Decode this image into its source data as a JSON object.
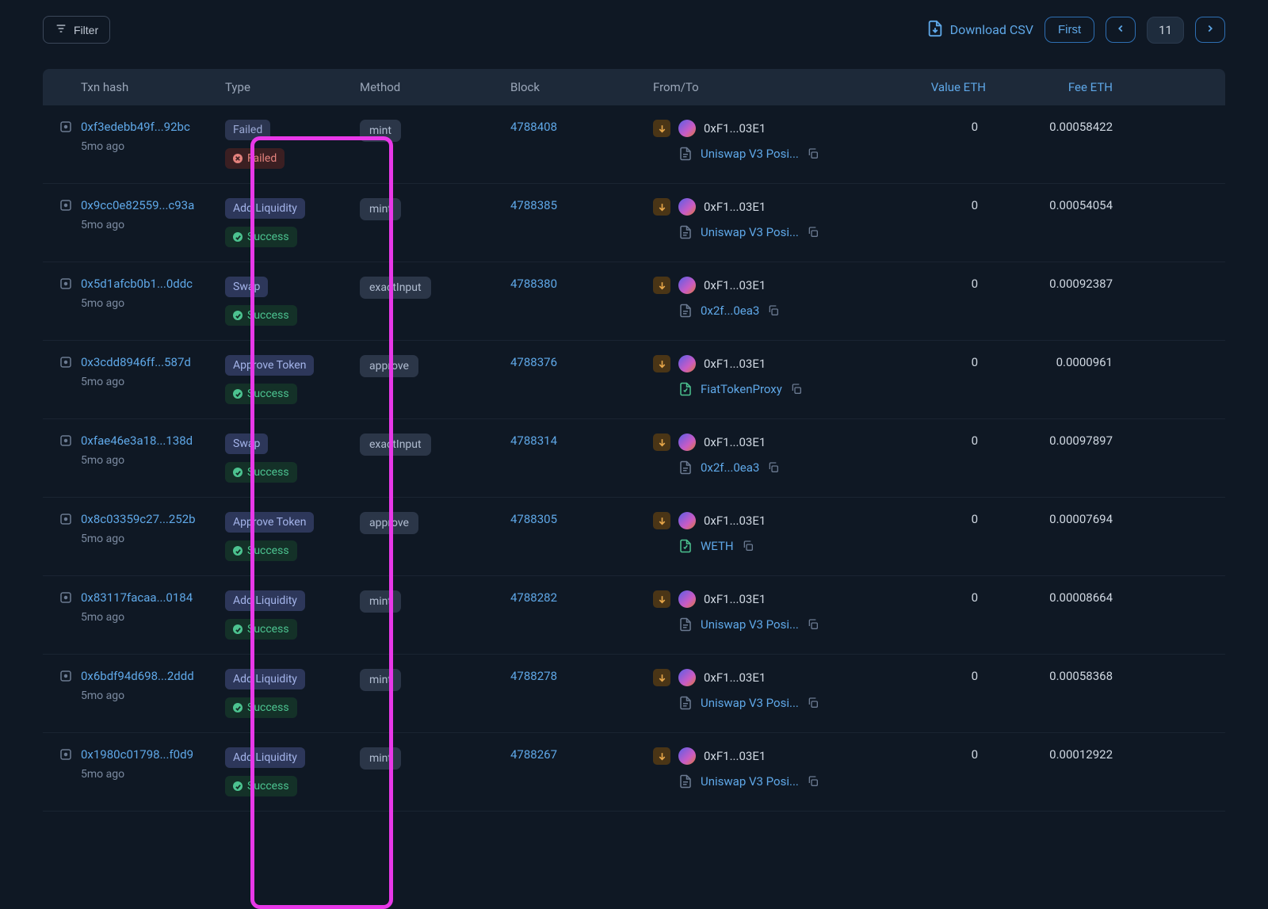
{
  "toolbar": {
    "filter_label": "Filter",
    "csv_label": "Download CSV",
    "first_label": "First",
    "current_page": "11"
  },
  "columns": {
    "hash": "Txn hash",
    "type": "Type",
    "method": "Method",
    "block": "Block",
    "fromto": "From/To",
    "value": "Value ETH",
    "fee": "Fee ETH"
  },
  "rows": [
    {
      "hash": "0xf3edebb49f...92bc",
      "age": "5mo ago",
      "type_tag": "Failed",
      "type_class": "tag-failed",
      "status": "Failed",
      "status_ok": false,
      "method": "mint",
      "block": "4788408",
      "from": "0xF1...03E1",
      "to": "Uniswap V3 Posi...",
      "to_icon": "doc",
      "value": "0",
      "fee": "0.00058422"
    },
    {
      "hash": "0x9cc0e82559...c93a",
      "age": "5mo ago",
      "type_tag": "Add Liquidity",
      "type_class": "tag-addliq",
      "status": "Success",
      "status_ok": true,
      "method": "mint",
      "block": "4788385",
      "from": "0xF1...03E1",
      "to": "Uniswap V3 Posi...",
      "to_icon": "doc",
      "value": "0",
      "fee": "0.00054054"
    },
    {
      "hash": "0x5d1afcb0b1...0ddc",
      "age": "5mo ago",
      "type_tag": "Swap",
      "type_class": "tag-swap",
      "status": "Success",
      "status_ok": true,
      "method": "exactInput",
      "block": "4788380",
      "from": "0xF1...03E1",
      "to": "0x2f...0ea3",
      "to_icon": "doc",
      "value": "0",
      "fee": "0.00092387"
    },
    {
      "hash": "0x3cdd8946ff...587d",
      "age": "5mo ago",
      "type_tag": "Approve Token",
      "type_class": "tag-approve",
      "status": "Success",
      "status_ok": true,
      "method": "approve",
      "block": "4788376",
      "from": "0xF1...03E1",
      "to": "FiatTokenProxy",
      "to_icon": "doc-green",
      "value": "0",
      "fee": "0.0000961"
    },
    {
      "hash": "0xfae46e3a18...138d",
      "age": "5mo ago",
      "type_tag": "Swap",
      "type_class": "tag-swap",
      "status": "Success",
      "status_ok": true,
      "method": "exactInput",
      "block": "4788314",
      "from": "0xF1...03E1",
      "to": "0x2f...0ea3",
      "to_icon": "doc",
      "value": "0",
      "fee": "0.00097897"
    },
    {
      "hash": "0x8c03359c27...252b",
      "age": "5mo ago",
      "type_tag": "Approve Token",
      "type_class": "tag-approve",
      "status": "Success",
      "status_ok": true,
      "method": "approve",
      "block": "4788305",
      "from": "0xF1...03E1",
      "to": "WETH",
      "to_icon": "doc-green",
      "value": "0",
      "fee": "0.00007694"
    },
    {
      "hash": "0x83117facaa...0184",
      "age": "5mo ago",
      "type_tag": "Add Liquidity",
      "type_class": "tag-addliq",
      "status": "Success",
      "status_ok": true,
      "method": "mint",
      "block": "4788282",
      "from": "0xF1...03E1",
      "to": "Uniswap V3 Posi...",
      "to_icon": "doc",
      "value": "0",
      "fee": "0.00008664"
    },
    {
      "hash": "0x6bdf94d698...2ddd",
      "age": "5mo ago",
      "type_tag": "Add Liquidity",
      "type_class": "tag-addliq",
      "status": "Success",
      "status_ok": true,
      "method": "mint",
      "block": "4788278",
      "from": "0xF1...03E1",
      "to": "Uniswap V3 Posi...",
      "to_icon": "doc",
      "value": "0",
      "fee": "0.00058368"
    },
    {
      "hash": "0x1980c01798...f0d9",
      "age": "5mo ago",
      "type_tag": "Add Liquidity",
      "type_class": "tag-addliq",
      "status": "Success",
      "status_ok": true,
      "method": "mint",
      "block": "4788267",
      "from": "0xF1...03E1",
      "to": "Uniswap V3 Posi...",
      "to_icon": "doc",
      "value": "0",
      "fee": "0.00012922"
    }
  ]
}
